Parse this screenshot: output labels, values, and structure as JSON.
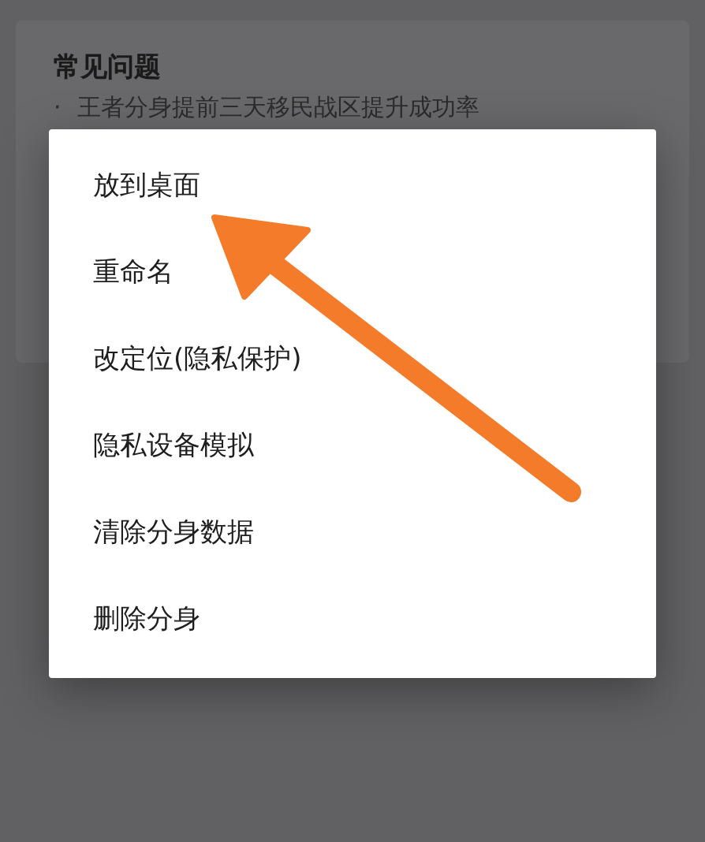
{
  "faq_card": {
    "title": "常见问题",
    "bullets": [
      {
        "marker": "·",
        "text": "王者分身提前三天移民战区提升成功率"
      }
    ]
  },
  "context_menu": {
    "items": [
      {
        "label": "放到桌面"
      },
      {
        "label": "重命名"
      },
      {
        "label": "改定位(隐私保护)"
      },
      {
        "label": "隐私设备模拟"
      },
      {
        "label": "清除分身数据"
      },
      {
        "label": "删除分身"
      }
    ]
  }
}
